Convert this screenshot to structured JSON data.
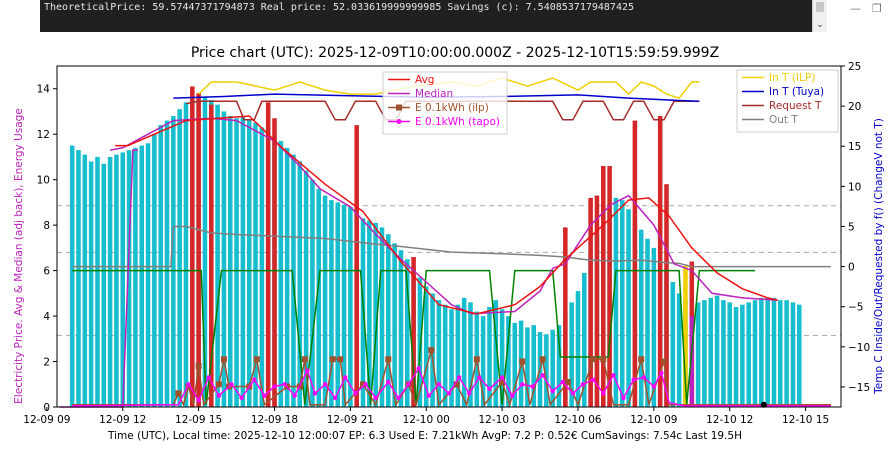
{
  "console": {
    "text": "TheoreticalPrice: 59.57447371794873 Real price: 52.033619999999985 Savings (c): 7.5408537179487425",
    "scroll_down_glyph": "⌄"
  },
  "window": {
    "minimize_glyph": "—",
    "restore_glyph": "❐"
  },
  "colors": {
    "bars": "#17becf",
    "hi_bars": "#d62728",
    "avg": "#ee1111",
    "median": "#bb22bb",
    "e_ilp": "#a0522d",
    "e_tapo": "#ff00ff",
    "in_ilp": "#f0d000",
    "in_tuya": "#0000cc",
    "request": "#a52a2a",
    "out": "#808080",
    "green": "#008000",
    "grid": "#aaaaaa"
  },
  "chart_data": {
    "type": "bar",
    "title": "Price chart (UTC): 2025-12-09T10:00:00.000Z - 2025-12-10T15:59:59.999Z",
    "xlabel": "Time (UTC), Local time: 2025-12-10 12:00:07 EP: 6.3 Used E: 7.21kWh AvgP: 7.2 P: 0.52€ CumSavings: 7.54c Last 19.5H",
    "ylabel_left": "Electricity Price. Avg & Median (adj back), Energy Usage",
    "ylabel_right": "Temp C Inside/Out/Requested by f() (ChangeV not T)",
    "xlim": [
      9.4,
      40.4
    ],
    "ylim_left": [
      0,
      15
    ],
    "ylim_right": [
      -17.5,
      25
    ],
    "x_ticks": [
      {
        "x": 9,
        "label": "12-09 09"
      },
      {
        "x": 12,
        "label": "12-09 12"
      },
      {
        "x": 15,
        "label": "12-09 15"
      },
      {
        "x": 18,
        "label": "12-09 18"
      },
      {
        "x": 21,
        "label": "12-09 21"
      },
      {
        "x": 24,
        "label": "12-10 00"
      },
      {
        "x": 27,
        "label": "12-10 03"
      },
      {
        "x": 30,
        "label": "12-10 06"
      },
      {
        "x": 33,
        "label": "12-10 09"
      },
      {
        "x": 36,
        "label": "12-10 12"
      },
      {
        "x": 39,
        "label": "12-10 15"
      }
    ],
    "y_ticks_left": [
      0,
      2,
      4,
      6,
      8,
      10,
      12,
      14
    ],
    "y_ticks_right": [
      -15,
      -10,
      -5,
      0,
      5,
      10,
      15,
      20,
      25
    ],
    "hgrid_left": [
      3.15,
      6.8,
      8.85
    ],
    "legend_left": [
      {
        "label": "Avg",
        "key": "avg"
      },
      {
        "label": "Median",
        "key": "median"
      },
      {
        "label": "E 0.1kWh (ilp)",
        "key": "e_ilp"
      },
      {
        "label": "E 0.1kWh (tapo)",
        "key": "e_tapo"
      }
    ],
    "legend_right": [
      {
        "label": "In T (ILP)",
        "key": "in_ilp"
      },
      {
        "label": "In T (Tuya)",
        "key": "in_tuya"
      },
      {
        "label": "Request T",
        "key": "request"
      },
      {
        "label": "Out T",
        "key": "out"
      }
    ],
    "price_x0": 10.0,
    "price_step": 0.25,
    "prices": [
      11.5,
      11.3,
      11.1,
      10.8,
      11.0,
      10.7,
      11.0,
      11.1,
      11.2,
      11.3,
      11.4,
      11.5,
      11.6,
      12.0,
      12.4,
      12.6,
      12.8,
      13.1,
      13.4,
      13.5,
      13.5,
      13.6,
      13.5,
      13.3,
      13.0,
      12.8,
      12.7,
      12.8,
      12.6,
      12.5,
      12.3,
      12.1,
      11.9,
      11.7,
      11.4,
      11.1,
      10.8,
      10.4,
      10.0,
      9.6,
      9.3,
      9.1,
      9.0,
      8.9,
      8.8,
      8.5,
      8.3,
      8.2,
      8.1,
      7.9,
      7.6,
      7.2,
      6.9,
      6.5,
      6.1,
      5.7,
      5.3,
      5.0,
      4.7,
      4.5,
      4.3,
      4.5,
      4.8,
      4.6,
      4.2,
      4.0,
      4.4,
      4.7,
      4.3,
      4.0,
      3.7,
      3.8,
      3.5,
      3.6,
      3.3,
      3.2,
      3.4,
      3.6,
      4.1,
      4.6,
      5.1,
      5.9,
      6.8,
      7.6,
      8.3,
      8.9,
      9.2,
      9.1,
      8.7,
      8.3,
      7.8,
      7.4,
      7.0,
      6.5,
      6.0,
      5.5,
      5.0,
      4.7,
      4.5,
      4.6,
      4.7,
      4.8,
      4.9,
      4.7,
      4.6,
      4.4,
      4.5,
      4.6,
      4.7,
      4.8,
      4.8,
      4.8,
      4.7,
      4.7,
      4.6,
      4.5
    ],
    "highlight_bars": [
      {
        "x": 14.75,
        "v": 14.1
      },
      {
        "x": 15.0,
        "v": 13.8
      },
      {
        "x": 15.5,
        "v": 13.3
      },
      {
        "x": 17.75,
        "v": 13.4
      },
      {
        "x": 18.0,
        "v": 12.7
      },
      {
        "x": 21.25,
        "v": 12.4
      },
      {
        "x": 23.5,
        "v": 6.6
      },
      {
        "x": 29.5,
        "v": 7.9
      },
      {
        "x": 30.5,
        "v": 9.2
      },
      {
        "x": 30.75,
        "v": 9.3
      },
      {
        "x": 31.0,
        "v": 10.6
      },
      {
        "x": 31.25,
        "v": 10.6
      },
      {
        "x": 32.25,
        "v": 12.6
      },
      {
        "x": 33.25,
        "v": 12.8
      },
      {
        "x": 33.5,
        "v": 9.8
      },
      {
        "x": 34.5,
        "v": 6.4
      }
    ],
    "extra_bars": [
      {
        "x": 34.25,
        "v": 6.2,
        "key": "in_ilp"
      },
      {
        "x": 34.5,
        "v": 4.0,
        "key": "median"
      }
    ],
    "avg": [
      [
        11.7,
        11.5
      ],
      [
        12.2,
        11.5
      ],
      [
        14.5,
        12.6
      ],
      [
        17.0,
        12.8
      ],
      [
        18.3,
        11.4
      ],
      [
        20.0,
        9.8
      ],
      [
        21.5,
        8.6
      ],
      [
        23.0,
        6.4
      ],
      [
        24.5,
        4.5
      ],
      [
        26.0,
        4.1
      ],
      [
        27.5,
        4.5
      ],
      [
        28.5,
        5.3
      ],
      [
        29.5,
        6.5
      ],
      [
        31.0,
        8.0
      ],
      [
        32.0,
        9.1
      ],
      [
        32.8,
        9.2
      ],
      [
        33.6,
        8.4
      ],
      [
        34.5,
        7.0
      ],
      [
        35.5,
        5.9
      ],
      [
        36.5,
        5.2
      ],
      [
        37.5,
        4.8
      ],
      [
        37.9,
        4.7
      ]
    ],
    "median": [
      [
        11.5,
        11.3
      ],
      [
        12.0,
        11.4
      ],
      [
        13.0,
        12.0
      ],
      [
        14.0,
        12.6
      ],
      [
        15.5,
        12.7
      ],
      [
        16.5,
        12.6
      ],
      [
        18.0,
        11.7
      ],
      [
        19.0,
        10.6
      ],
      [
        19.8,
        9.6
      ],
      [
        21.0,
        8.8
      ],
      [
        22.0,
        7.6
      ],
      [
        23.0,
        6.5
      ],
      [
        24.0,
        5.5
      ],
      [
        25.0,
        4.5
      ],
      [
        25.8,
        4.1
      ],
      [
        27.5,
        4.2
      ],
      [
        28.5,
        5.1
      ],
      [
        29.0,
        6.1
      ],
      [
        29.5,
        6.3
      ],
      [
        30.5,
        8.0
      ],
      [
        31.3,
        8.9
      ],
      [
        32.0,
        9.3
      ],
      [
        33.0,
        8.0
      ],
      [
        33.8,
        6.3
      ],
      [
        34.5,
        6.0
      ],
      [
        35.3,
        5.0
      ],
      [
        36.5,
        4.8
      ],
      [
        37.9,
        4.7
      ]
    ],
    "purple_step": [
      [
        9.5,
        0
      ],
      [
        12.0,
        0
      ],
      [
        12.4,
        11.3
      ],
      [
        12.6,
        11.3
      ]
    ],
    "green_line": [
      [
        10.0,
        6.0
      ],
      [
        15.0,
        6.0
      ],
      [
        15.05,
        6.0
      ],
      [
        15.1,
        6.0
      ],
      [
        15.3,
        0.1
      ],
      [
        15.9,
        6.0
      ],
      [
        18.7,
        6.0
      ],
      [
        19.2,
        0.1
      ],
      [
        19.8,
        6.0
      ],
      [
        21.4,
        6.0
      ],
      [
        21.8,
        0.1
      ],
      [
        22.2,
        6.0
      ],
      [
        23.2,
        6.0
      ],
      [
        23.6,
        0.1
      ],
      [
        24.0,
        6.0
      ],
      [
        26.5,
        6.0
      ],
      [
        27.0,
        0.1
      ],
      [
        27.5,
        6.0
      ],
      [
        29.0,
        6.0
      ],
      [
        29.3,
        2.2
      ],
      [
        31.2,
        2.2
      ],
      [
        31.5,
        6.0
      ],
      [
        34.0,
        6.0
      ],
      [
        34.3,
        0.1
      ],
      [
        34.8,
        6.0
      ],
      [
        37.0,
        6.0
      ]
    ],
    "temp_ilp": [
      [
        15.0,
        21.5
      ],
      [
        15.5,
        23.0
      ],
      [
        16.5,
        23.0
      ],
      [
        18.0,
        22.0
      ],
      [
        19.0,
        23.0
      ],
      [
        20.0,
        22.0
      ],
      [
        21.0,
        21.5
      ],
      [
        22.0,
        21.5
      ],
      [
        23.5,
        22.5
      ],
      [
        25.0,
        23.0
      ],
      [
        26.0,
        22.5
      ],
      [
        27.0,
        23.5
      ],
      [
        28.0,
        22.5
      ],
      [
        29.0,
        23.5
      ],
      [
        30.0,
        22.0
      ],
      [
        30.5,
        23.0
      ],
      [
        31.5,
        23.0
      ],
      [
        32.0,
        21.5
      ],
      [
        32.5,
        23.0
      ],
      [
        33.0,
        22.5
      ],
      [
        33.5,
        21.5
      ],
      [
        34.0,
        21.0
      ],
      [
        34.5,
        23.0
      ],
      [
        34.8,
        23.0
      ]
    ],
    "temp_tuya": [
      [
        14.0,
        21.0
      ],
      [
        16.0,
        21.2
      ],
      [
        18.0,
        21.5
      ],
      [
        21.0,
        21.3
      ],
      [
        24.0,
        21.1
      ],
      [
        27.0,
        21.2
      ],
      [
        30.0,
        21.4
      ],
      [
        32.0,
        21.0
      ],
      [
        34.0,
        20.7
      ],
      [
        34.8,
        20.6
      ]
    ],
    "temp_request": [
      [
        14.5,
        20.3
      ],
      [
        15.0,
        20.6
      ],
      [
        16.5,
        20.6
      ],
      [
        16.8,
        18.3
      ],
      [
        17.2,
        18.3
      ],
      [
        17.5,
        20.6
      ],
      [
        20.0,
        20.6
      ],
      [
        20.4,
        18.3
      ],
      [
        20.8,
        18.3
      ],
      [
        21.2,
        20.6
      ],
      [
        22.0,
        20.6
      ],
      [
        22.4,
        18.3
      ],
      [
        22.8,
        18.3
      ],
      [
        23.2,
        20.6
      ],
      [
        29.0,
        20.6
      ],
      [
        29.4,
        18.3
      ],
      [
        29.8,
        18.3
      ],
      [
        30.2,
        20.6
      ],
      [
        31.0,
        20.6
      ],
      [
        31.4,
        18.3
      ],
      [
        31.8,
        18.3
      ],
      [
        32.2,
        20.6
      ],
      [
        32.6,
        20.6
      ],
      [
        33.0,
        18.3
      ],
      [
        33.4,
        18.3
      ],
      [
        33.8,
        20.6
      ],
      [
        34.8,
        20.6
      ]
    ],
    "temp_out": [
      [
        10.0,
        0.0
      ],
      [
        13.9,
        0.0
      ],
      [
        14.0,
        5.0
      ],
      [
        14.5,
        5.0
      ],
      [
        15.5,
        4.2
      ],
      [
        16.5,
        4.0
      ],
      [
        18.0,
        3.8
      ],
      [
        20.0,
        3.5
      ],
      [
        22.0,
        2.8
      ],
      [
        23.0,
        2.5
      ],
      [
        25.0,
        1.8
      ],
      [
        27.0,
        1.6
      ],
      [
        28.5,
        1.4
      ],
      [
        29.5,
        1.2
      ],
      [
        30.5,
        0.8
      ],
      [
        31.5,
        0.7
      ],
      [
        32.5,
        0.8
      ],
      [
        33.5,
        0.5
      ],
      [
        34.0,
        0.4
      ],
      [
        34.5,
        0.0
      ],
      [
        40.0,
        0.0
      ]
    ],
    "e_ilp": [
      [
        10.0,
        0.1
      ],
      [
        14.0,
        0.1
      ],
      [
        14.2,
        0.6
      ],
      [
        14.4,
        0.1
      ],
      [
        14.6,
        0.9
      ],
      [
        14.8,
        0.1
      ],
      [
        15.0,
        1.8
      ],
      [
        15.2,
        0.1
      ],
      [
        15.8,
        1.0
      ],
      [
        16.0,
        2.1
      ],
      [
        16.2,
        0.9
      ],
      [
        17.0,
        0.9
      ],
      [
        17.3,
        2.1
      ],
      [
        17.6,
        0.1
      ],
      [
        18.5,
        0.9
      ],
      [
        19.0,
        0.9
      ],
      [
        19.2,
        2.1
      ],
      [
        19.4,
        0.1
      ],
      [
        20.0,
        0.1
      ],
      [
        20.3,
        2.1
      ],
      [
        20.6,
        2.1
      ],
      [
        20.8,
        0.1
      ],
      [
        21.5,
        1.0
      ],
      [
        22.0,
        0.1
      ],
      [
        22.5,
        2.1
      ],
      [
        22.8,
        0.1
      ],
      [
        23.3,
        1.0
      ],
      [
        23.6,
        0.1
      ],
      [
        24.2,
        2.5
      ],
      [
        24.5,
        0.1
      ],
      [
        25.2,
        1.0
      ],
      [
        25.6,
        0.1
      ],
      [
        26.0,
        2.1
      ],
      [
        26.3,
        0.1
      ],
      [
        27.0,
        1.1
      ],
      [
        27.3,
        0.1
      ],
      [
        27.8,
        2.0
      ],
      [
        28.1,
        0.1
      ],
      [
        28.6,
        2.1
      ],
      [
        28.9,
        0.1
      ],
      [
        29.6,
        1.1
      ],
      [
        30.0,
        0.1
      ],
      [
        30.6,
        2.1
      ],
      [
        31.0,
        2.1
      ],
      [
        31.4,
        0.1
      ],
      [
        32.0,
        0.1
      ],
      [
        32.5,
        2.1
      ],
      [
        32.8,
        0.1
      ],
      [
        33.4,
        2.0
      ],
      [
        33.6,
        0.1
      ],
      [
        34.0,
        0.1
      ],
      [
        40.0,
        0.1
      ]
    ],
    "e_tapo": [
      [
        10.0,
        0.05
      ],
      [
        14.2,
        0.1
      ],
      [
        14.6,
        1.0
      ],
      [
        15.0,
        0.3
      ],
      [
        15.4,
        1.3
      ],
      [
        15.8,
        0.5
      ],
      [
        16.3,
        1.0
      ],
      [
        16.7,
        0.4
      ],
      [
        17.2,
        1.2
      ],
      [
        17.6,
        0.5
      ],
      [
        18.0,
        0.9
      ],
      [
        18.4,
        1.0
      ],
      [
        18.8,
        0.5
      ],
      [
        19.3,
        1.6
      ],
      [
        19.6,
        0.6
      ],
      [
        20.0,
        1.0
      ],
      [
        20.4,
        0.4
      ],
      [
        20.8,
        1.3
      ],
      [
        21.2,
        0.6
      ],
      [
        21.6,
        1.0
      ],
      [
        22.0,
        0.4
      ],
      [
        22.5,
        1.1
      ],
      [
        22.9,
        0.4
      ],
      [
        23.3,
        1.0
      ],
      [
        23.7,
        1.7
      ],
      [
        24.1,
        0.5
      ],
      [
        24.5,
        1.0
      ],
      [
        24.9,
        0.6
      ],
      [
        25.3,
        1.3
      ],
      [
        25.7,
        0.6
      ],
      [
        26.1,
        1.3
      ],
      [
        26.5,
        0.8
      ],
      [
        27.0,
        1.3
      ],
      [
        27.4,
        0.5
      ],
      [
        27.8,
        1.0
      ],
      [
        28.2,
        0.9
      ],
      [
        28.6,
        1.4
      ],
      [
        29.0,
        0.7
      ],
      [
        29.4,
        1.1
      ],
      [
        29.8,
        0.6
      ],
      [
        30.2,
        1.0
      ],
      [
        30.6,
        1.2
      ],
      [
        31.0,
        0.6
      ],
      [
        31.4,
        1.4
      ],
      [
        31.8,
        0.4
      ],
      [
        32.2,
        1.2
      ],
      [
        32.6,
        1.3
      ],
      [
        33.0,
        0.9
      ],
      [
        33.3,
        1.5
      ],
      [
        33.6,
        0.2
      ],
      [
        34.2,
        0.05
      ],
      [
        40.0,
        0.05
      ]
    ],
    "marker": {
      "x": 37.35,
      "y": 0.1
    }
  }
}
